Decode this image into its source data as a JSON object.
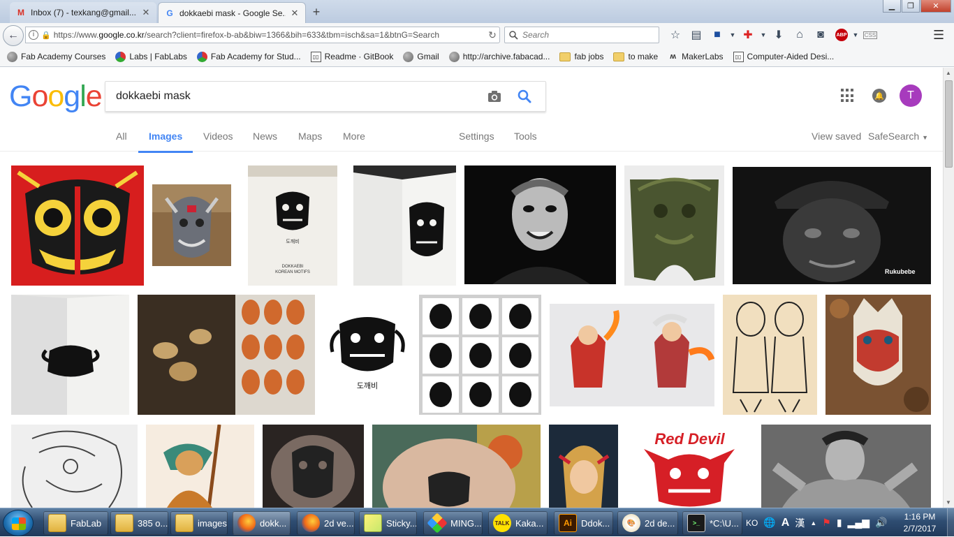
{
  "browser": {
    "tabs": [
      {
        "title": "Inbox (7) - texkang@gmail....",
        "favicon": "gmail-icon",
        "active": false
      },
      {
        "title": "dokkaebi mask - Google Se...",
        "favicon": "google-icon",
        "active": true
      }
    ],
    "new_tab_glyph": "+",
    "url_prefix": "https://www.",
    "url_host": "google.co.kr",
    "url_path": "/search?client=firefox-b-ab&biw=1366&bih=633&tbm=isch&sa=1&btnG=Search",
    "search_placeholder": "Search",
    "bookmarks": [
      {
        "label": "Fab Academy Courses",
        "icon": "globe-icon"
      },
      {
        "label": "Labs | FabLabs",
        "icon": "fablab-icon"
      },
      {
        "label": "Fab Academy for Stud...",
        "icon": "fablab-icon"
      },
      {
        "label": "Readme · GitBook",
        "icon": "book-icon"
      },
      {
        "label": "Gmail",
        "icon": "globe-icon"
      },
      {
        "label": "http://archive.fabacad...",
        "icon": "globe-icon"
      },
      {
        "label": "fab jobs",
        "icon": "folder-icon"
      },
      {
        "label": "to make",
        "icon": "folder-icon"
      },
      {
        "label": "MakerLabs",
        "icon": "makerlabs-icon"
      },
      {
        "label": "Computer-Aided Desi...",
        "icon": "book-icon"
      }
    ]
  },
  "google": {
    "logo_letters": [
      {
        "ch": "G",
        "color": "#4285F4"
      },
      {
        "ch": "o",
        "color": "#EA4335"
      },
      {
        "ch": "o",
        "color": "#FBBC05"
      },
      {
        "ch": "g",
        "color": "#4285F4"
      },
      {
        "ch": "l",
        "color": "#34A853"
      },
      {
        "ch": "e",
        "color": "#EA4335"
      }
    ],
    "query": "dokkaebi mask",
    "avatar_letter": "T",
    "avatar_color": "#A73BBD",
    "accent": "#4285F4",
    "tabs": {
      "all": "All",
      "images": "Images",
      "videos": "Videos",
      "news": "News",
      "maps": "Maps",
      "more": "More",
      "settings": "Settings",
      "tools": "Tools",
      "view_saved": "View saved",
      "safesearch": "SafeSearch"
    }
  },
  "image_results": {
    "rows": 3,
    "count": 22,
    "visible_text": {
      "rukubebe_watermark": "Rukubebe",
      "red_devil_title": "Red Devil",
      "book_caption_korean": "도깨비",
      "book_caption_line1": "DOKKAEBI",
      "book_caption_line2": "KOREAN MOTIFS",
      "motif_caption_korean": "도깨비"
    }
  },
  "taskbar": {
    "items": [
      {
        "label": "FabLab",
        "icon": "folder-icon"
      },
      {
        "label": "385 o...",
        "icon": "folder-icon"
      },
      {
        "label": "images",
        "icon": "folder-icon"
      },
      {
        "label": "dokk...",
        "icon": "firefox-icon",
        "active": true
      },
      {
        "label": "2d ve...",
        "icon": "firefox-icon"
      },
      {
        "label": "Sticky...",
        "icon": "sticky-notes-icon"
      },
      {
        "label": "MING...",
        "icon": "mingw-icon"
      },
      {
        "label": "Kaka...",
        "icon": "kakaotalk-icon"
      },
      {
        "label": "Ddok...",
        "icon": "illustrator-icon"
      },
      {
        "label": "2d de...",
        "icon": "paint-icon"
      },
      {
        "label": "*C:\\U...",
        "icon": "command-prompt-icon"
      }
    ],
    "kakao_badge": "TALK",
    "ai_badge": "Ai",
    "lang": "KO",
    "ime_a": "A",
    "ime_han": "漢",
    "time": "1:16 PM",
    "date": "2/7/2017"
  }
}
